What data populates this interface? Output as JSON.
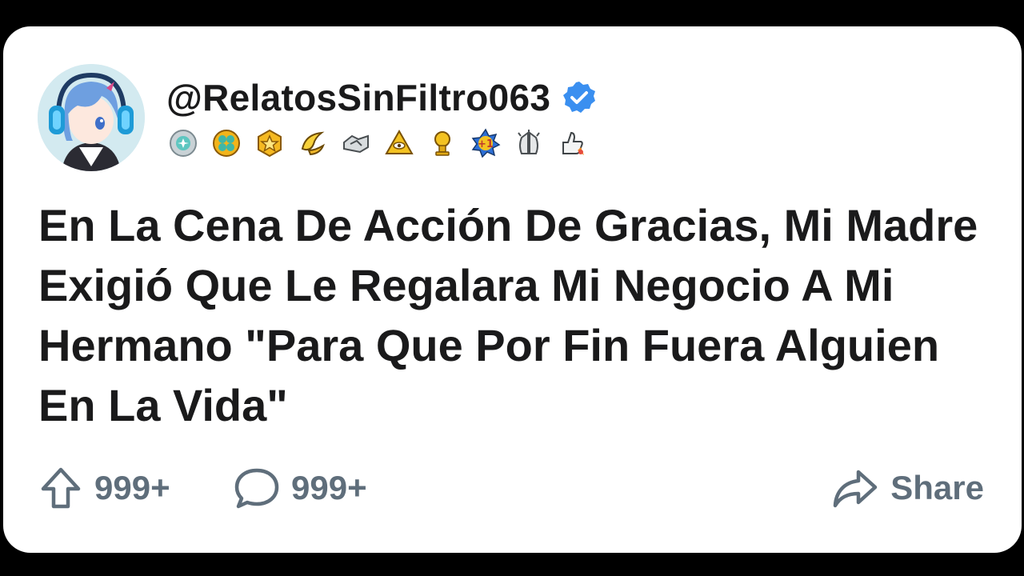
{
  "post": {
    "username": "@RelatosSinFiltro063",
    "verified_icon": "verified-badge-icon",
    "badges": [
      "silver-award-icon",
      "gold-clover-award-icon",
      "gold-star-award-icon",
      "banana-award-icon",
      "handshake-award-icon",
      "pyramid-eye-award-icon",
      "gold-trophy-award-icon",
      "plus-one-award-icon",
      "praying-hands-award-icon",
      "thumbs-up-rocket-award-icon"
    ],
    "title": "En La Cena De Acción De Gracias, Mi Madre Exigió Que Le Regalara Mi Negocio A Mi Hermano \"Para Que Por Fin Fuera Alguien En La Vida\""
  },
  "actions": {
    "upvotes": "999+",
    "comments": "999+",
    "share_label": "Share"
  },
  "colors": {
    "background": "#000000",
    "card": "#ffffff",
    "text": "#1a1a1b",
    "muted": "#5f6e7b",
    "verified": "#3a8ff0"
  }
}
